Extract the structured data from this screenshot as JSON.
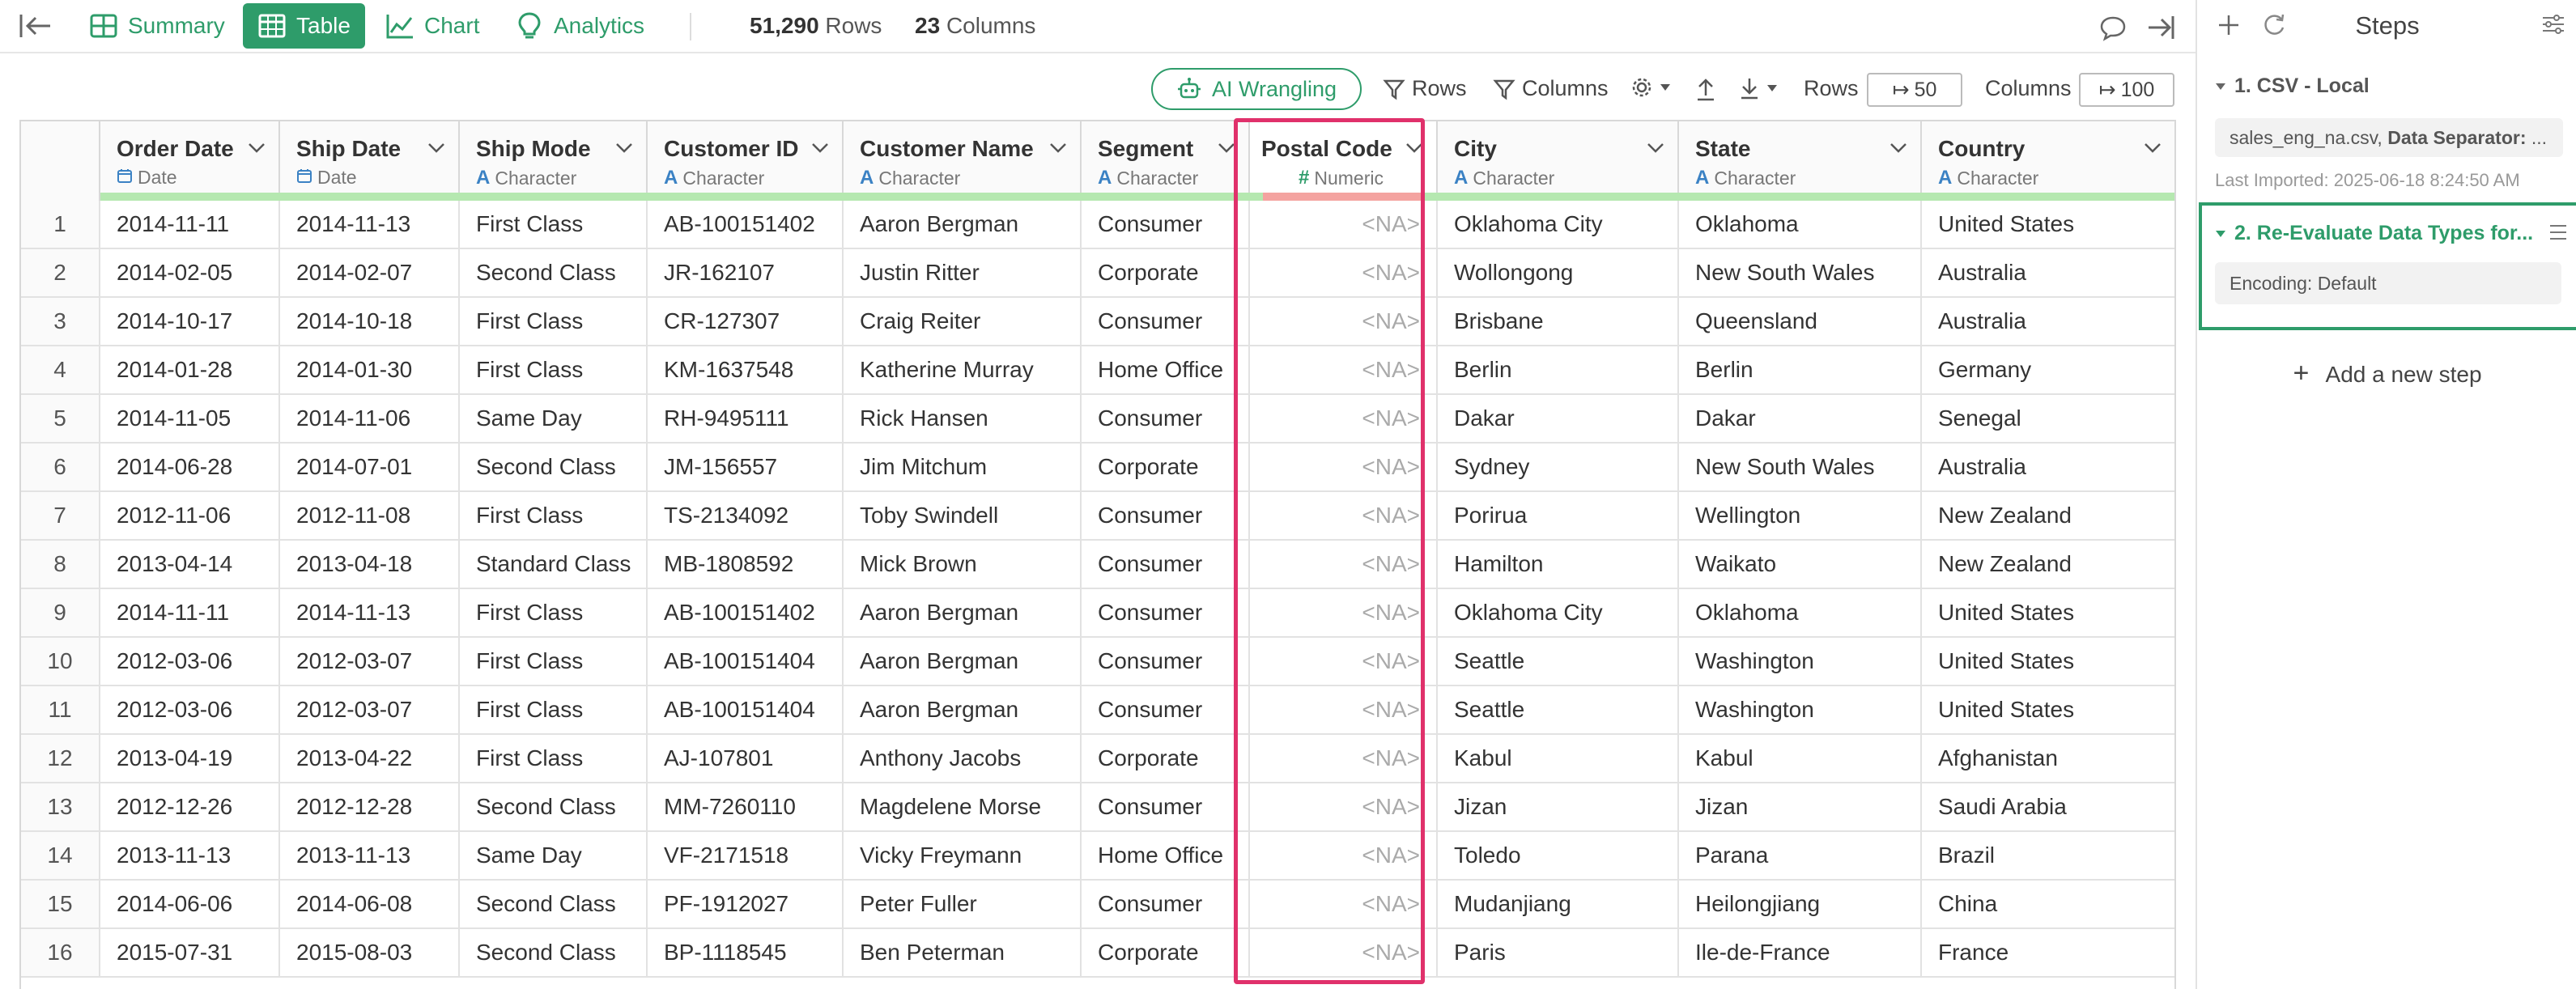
{
  "topbar": {
    "tabs": [
      {
        "label": "Summary",
        "icon": "summary-grid-icon"
      },
      {
        "label": "Table",
        "icon": "table-icon",
        "active": true
      },
      {
        "label": "Chart",
        "icon": "chart-icon"
      },
      {
        "label": "Analytics",
        "icon": "lightbulb-icon"
      }
    ],
    "rows_count": "51,290",
    "rows_label": "Rows",
    "cols_count": "23",
    "cols_label": "Columns"
  },
  "toolbar": {
    "ai_label": "AI Wrangling",
    "rows_filter": "Rows",
    "cols_filter": "Columns",
    "rows_label": "Rows",
    "rows_value": "50",
    "cols_label": "Columns",
    "cols_value": "100"
  },
  "table": {
    "columns": [
      {
        "name": "Order Date",
        "type": "Date",
        "type_icon": "calendar-icon"
      },
      {
        "name": "Ship Date",
        "type": "Date",
        "type_icon": "calendar-icon"
      },
      {
        "name": "Ship Mode",
        "type": "Character",
        "type_icon": "character-a-icon"
      },
      {
        "name": "Customer ID",
        "type": "Character",
        "type_icon": "character-a-icon"
      },
      {
        "name": "Customer Name",
        "type": "Character",
        "type_icon": "character-a-icon"
      },
      {
        "name": "Segment",
        "type": "Character",
        "type_icon": "character-a-icon"
      },
      {
        "name": "Postal Code",
        "type": "Numeric",
        "type_icon": "hash-icon"
      },
      {
        "name": "City",
        "type": "Character",
        "type_icon": "character-a-icon"
      },
      {
        "name": "State",
        "type": "Character",
        "type_icon": "character-a-icon"
      },
      {
        "name": "Country",
        "type": "Character",
        "type_icon": "character-a-icon"
      }
    ],
    "rows": [
      [
        "1",
        "2014-11-11",
        "2014-11-13",
        "First Class",
        "AB-100151402",
        "Aaron Bergman",
        "Consumer",
        "<NA>",
        "Oklahoma City",
        "Oklahoma",
        "United States"
      ],
      [
        "2",
        "2014-02-05",
        "2014-02-07",
        "Second Class",
        "JR-162107",
        "Justin Ritter",
        "Corporate",
        "<NA>",
        "Wollongong",
        "New South Wales",
        "Australia"
      ],
      [
        "3",
        "2014-10-17",
        "2014-10-18",
        "First Class",
        "CR-127307",
        "Craig Reiter",
        "Consumer",
        "<NA>",
        "Brisbane",
        "Queensland",
        "Australia"
      ],
      [
        "4",
        "2014-01-28",
        "2014-01-30",
        "First Class",
        "KM-1637548",
        "Katherine Murray",
        "Home Office",
        "<NA>",
        "Berlin",
        "Berlin",
        "Germany"
      ],
      [
        "5",
        "2014-11-05",
        "2014-11-06",
        "Same Day",
        "RH-9495111",
        "Rick Hansen",
        "Consumer",
        "<NA>",
        "Dakar",
        "Dakar",
        "Senegal"
      ],
      [
        "6",
        "2014-06-28",
        "2014-07-01",
        "Second Class",
        "JM-156557",
        "Jim Mitchum",
        "Corporate",
        "<NA>",
        "Sydney",
        "New South Wales",
        "Australia"
      ],
      [
        "7",
        "2012-11-06",
        "2012-11-08",
        "First Class",
        "TS-2134092",
        "Toby Swindell",
        "Consumer",
        "<NA>",
        "Porirua",
        "Wellington",
        "New Zealand"
      ],
      [
        "8",
        "2013-04-14",
        "2013-04-18",
        "Standard Class",
        "MB-1808592",
        "Mick Brown",
        "Consumer",
        "<NA>",
        "Hamilton",
        "Waikato",
        "New Zealand"
      ],
      [
        "9",
        "2014-11-11",
        "2014-11-13",
        "First Class",
        "AB-100151402",
        "Aaron Bergman",
        "Consumer",
        "<NA>",
        "Oklahoma City",
        "Oklahoma",
        "United States"
      ],
      [
        "10",
        "2012-03-06",
        "2012-03-07",
        "First Class",
        "AB-100151404",
        "Aaron Bergman",
        "Consumer",
        "<NA>",
        "Seattle",
        "Washington",
        "United States"
      ],
      [
        "11",
        "2012-03-06",
        "2012-03-07",
        "First Class",
        "AB-100151404",
        "Aaron Bergman",
        "Consumer",
        "<NA>",
        "Seattle",
        "Washington",
        "United States"
      ],
      [
        "12",
        "2013-04-19",
        "2013-04-22",
        "First Class",
        "AJ-107801",
        "Anthony Jacobs",
        "Corporate",
        "<NA>",
        "Kabul",
        "Kabul",
        "Afghanistan"
      ],
      [
        "13",
        "2012-12-26",
        "2012-12-28",
        "Second Class",
        "MM-7260110",
        "Magdelene Morse",
        "Consumer",
        "<NA>",
        "Jizan",
        "Jizan",
        "Saudi Arabia"
      ],
      [
        "14",
        "2013-11-13",
        "2013-11-13",
        "Same Day",
        "VF-2171518",
        "Vicky Freymann",
        "Home Office",
        "<NA>",
        "Toledo",
        "Parana",
        "Brazil"
      ],
      [
        "15",
        "2014-06-06",
        "2014-06-08",
        "Second Class",
        "PF-1912027",
        "Peter Fuller",
        "Consumer",
        "<NA>",
        "Mudanjiang",
        "Heilongjiang",
        "China"
      ],
      [
        "16",
        "2015-07-31",
        "2015-08-03",
        "Second Class",
        "BP-1118545",
        "Ben Peterman",
        "Corporate",
        "<NA>",
        "Paris",
        "Ile-de-France",
        "France"
      ]
    ]
  },
  "panel": {
    "title": "Steps",
    "step1_title": "1. CSV - Local",
    "step1_file": "sales_eng_na.csv,",
    "step1_sep_label": "Data Separator:",
    "step1_more": "...",
    "step1_meta": "Last Imported: 2025-06-18 8:24:50 AM",
    "step2_title": "2. Re-Evaluate Data Types for...",
    "step2_detail": "Encoding: Default",
    "add_step": "Add a new step"
  },
  "colors": {
    "accent": "#2e9c6a",
    "highlight": "#e0316b",
    "quality_ok": "#b5e8b0",
    "quality_bad": "#f4a3a0"
  }
}
